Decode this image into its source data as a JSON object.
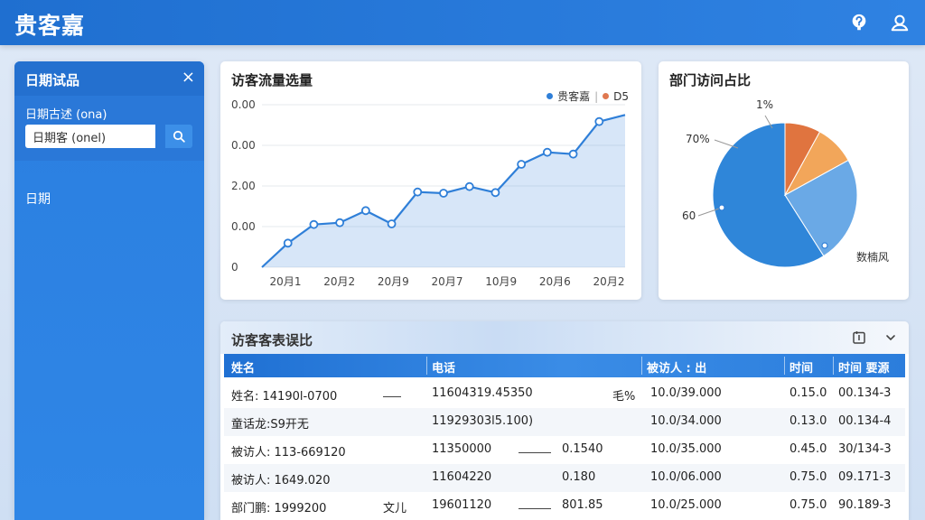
{
  "app": {
    "brand": "贵客嘉"
  },
  "sidebar": {
    "title": "日期试品",
    "close_glyph": "×",
    "filter_label": "日期古述 (ona)",
    "input_value": "日期客 (onel)",
    "item": "日期"
  },
  "line_card": {
    "title": "访客流量选量",
    "legend": [
      {
        "label": "贵客嘉",
        "color": "#2f7fd8"
      },
      {
        "label": "D5",
        "color": "#e07850"
      }
    ],
    "separator": "|"
  },
  "pie_card": {
    "title": "部门访问占比",
    "labels": {
      "top": "1%",
      "left_top": "70%",
      "left": "60",
      "right": "数楠风"
    }
  },
  "chart_data": [
    {
      "type": "line",
      "title": "访客流量选量",
      "y_tick_labels": [
        "0.00",
        "0.00",
        "2.00",
        "0.00",
        "0"
      ],
      "x_tick_labels": [
        "20月1",
        "20月2",
        "20月9",
        "20月7",
        "10月9",
        "20月6",
        "20月2"
      ],
      "series": [
        {
          "name": "贵客嘉",
          "color": "#2f7fd8",
          "values": [
            0,
            0.4,
            0.71,
            0.74,
            0.94,
            0.72,
            1.25,
            1.23,
            1.34,
            1.24,
            1.71,
            1.91,
            1.88,
            2.42,
            2.53
          ]
        }
      ],
      "ylim": [
        0,
        2.7
      ],
      "area_fill": true
    },
    {
      "type": "pie",
      "title": "部门访问占比",
      "slices": [
        {
          "value": 59,
          "color": "#2f86d9"
        },
        {
          "value": 24,
          "color": "#6aa9e6"
        },
        {
          "value": 9,
          "color": "#f2a65a"
        },
        {
          "value": 8,
          "color": "#e0743f"
        }
      ]
    }
  ],
  "table": {
    "title": "访客客表误比",
    "headers": [
      "姓名",
      "电话",
      "被访人 : 出",
      "时间",
      "时间 要源"
    ],
    "rows": [
      {
        "c1": "姓名: 14190l-0700",
        "c2": "11604319.45350",
        "c3": "毛%",
        "c4": "10.0/39.000",
        "c5": "0.15.0",
        "c6": "00.134-3"
      },
      {
        "c1": "童话龙:S9开无",
        "c2": "11929303l5.100)",
        "c3": "",
        "c4": "10.0/34.000",
        "c5": "0.13.0",
        "c6": "00.134-4"
      },
      {
        "c1": "被访人: 113-669120",
        "c2": "11350000",
        "c3": "0.1540",
        "c4": "10.0/35.000",
        "c5": "0.45.0",
        "c6": "30/134-3"
      },
      {
        "c1": "被访人: 1649.020",
        "c2": "11604220",
        "c3": "0.180",
        "c4": "10.0/06.000",
        "c5": "0.75.0",
        "c6": "09.171-3"
      },
      {
        "c1": "部门鹏: 1999200",
        "c2": "19601120",
        "c3": "801.85",
        "c4": "10.0/25.000",
        "c5": "0.75.0",
        "c6": "90.189-3",
        "mark": "文儿"
      }
    ]
  }
}
